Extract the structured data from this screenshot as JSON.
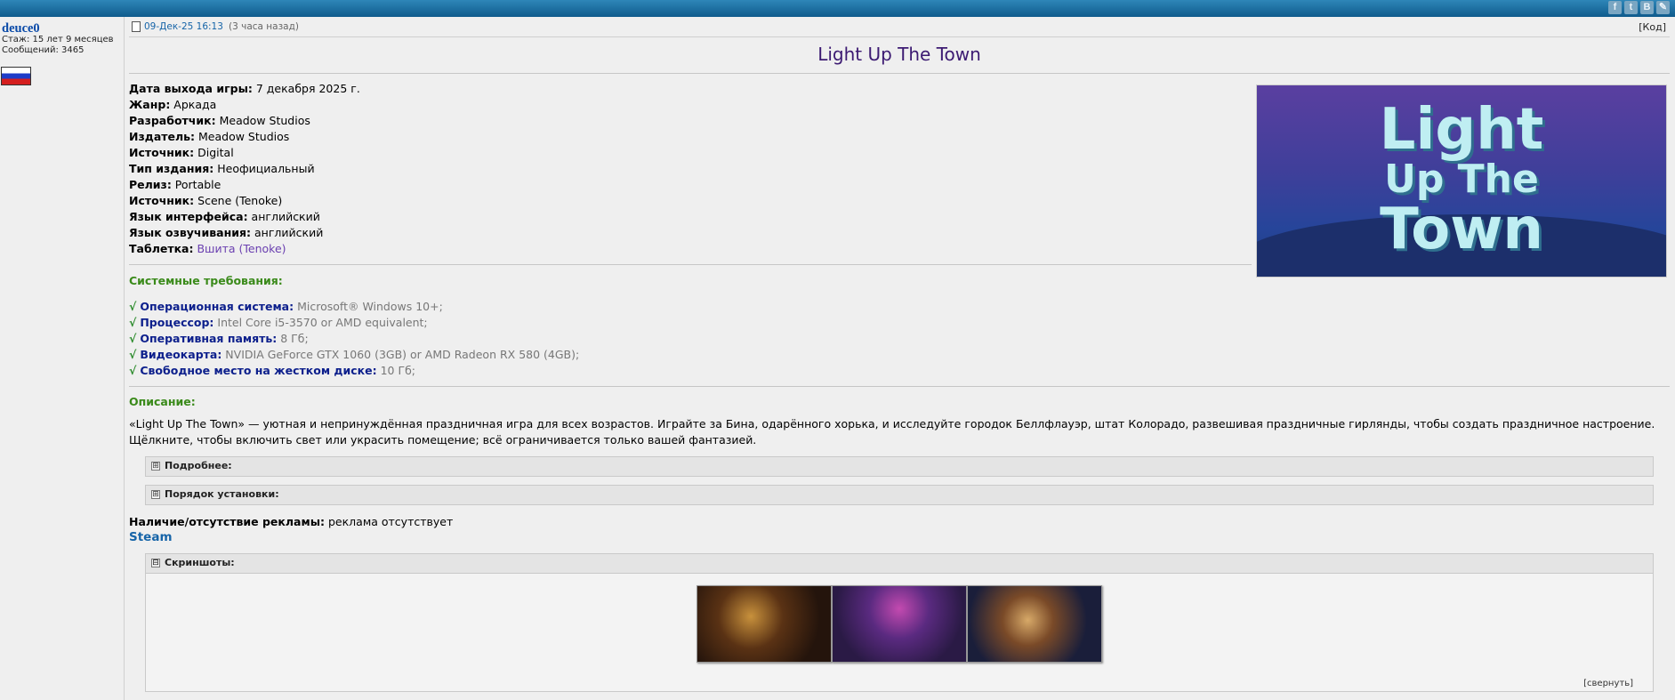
{
  "social": {
    "icons": [
      "facebook-icon",
      "twitter-icon",
      "vk-icon",
      "other-share-icon"
    ],
    "letters": [
      "f",
      "t",
      "B",
      "✎"
    ]
  },
  "user": {
    "name": "deuce0",
    "stage": "Стаж: 15 лет 9 месяцев",
    "posts": "Сообщений: 3465"
  },
  "post": {
    "date": "09-Дек-25 16:13",
    "ago": "(3 часа назад)",
    "code_label": "[Код]",
    "title": "Light Up The Town"
  },
  "cover": {
    "line1": "Light",
    "line2": "Up The",
    "line3": "Town"
  },
  "info": [
    {
      "label": "Дата выхода игры:",
      "value": " 7 декабря 2025 г."
    },
    {
      "label": "Жанр:",
      "value": " Аркада"
    },
    {
      "label": "Разработчик:",
      "value": " Meadow Studios"
    },
    {
      "label": "Издатель:",
      "value": " Meadow Studios"
    },
    {
      "label": "Источник:",
      "value": " Digital"
    },
    {
      "label": "Тип издания:",
      "value": " Неофициальный"
    },
    {
      "label": "Релиз:",
      "value": " Portable"
    },
    {
      "label": "Источник:",
      "value": " Scene (Tenoke)"
    },
    {
      "label": "Язык интерфейса:",
      "value": " английский"
    },
    {
      "label": "Язык озвучивания:",
      "value": " английский"
    },
    {
      "label": "Таблетка:",
      "value": " Вшита (Tenoke)"
    }
  ],
  "sysreq": {
    "heading": "Системные требования:",
    "items": [
      {
        "label": "Операционная система:",
        "value": " Microsoft® Windows 10+;"
      },
      {
        "label": "Процессор:",
        "value": " Intel Core i5-3570 or AMD equivalent;"
      },
      {
        "label": "Оперативная память:",
        "value": " 8 Гб;"
      },
      {
        "label": "Видеокарта:",
        "value": " NVIDIA GeForce GTX 1060 (3GB) or AMD Radeon RX 580 (4GB);"
      },
      {
        "label": "Свободное место на жестком диске:",
        "value": " 10 Гб;"
      }
    ],
    "check": "√"
  },
  "description": {
    "heading": "Описание:",
    "text": "«Light Up The Town» — уютная и непринуждённая праздничная игра для всех возрастов. Играйте за Бина, одарённого хорька, и исследуйте городок Беллфлауэр, штат Колорадо, развешивая праздничные гирлянды, чтобы создать праздничное настроение. Щёлкните, чтобы включить свет или украсить помещение; всё ограничивается только вашей фантазией."
  },
  "spoilers": [
    {
      "label": "Подробнее:",
      "icon": "⊞"
    },
    {
      "label": "Порядок установки:",
      "icon": "⊞"
    }
  ],
  "ads": {
    "label": "Наличие/отсутствие рекламы:",
    "value": " реклама отсутствует"
  },
  "steam": "Steam",
  "screenshots": {
    "label": "Скриншоты:",
    "icon": "⊟",
    "collapse": "[свернуть]"
  }
}
